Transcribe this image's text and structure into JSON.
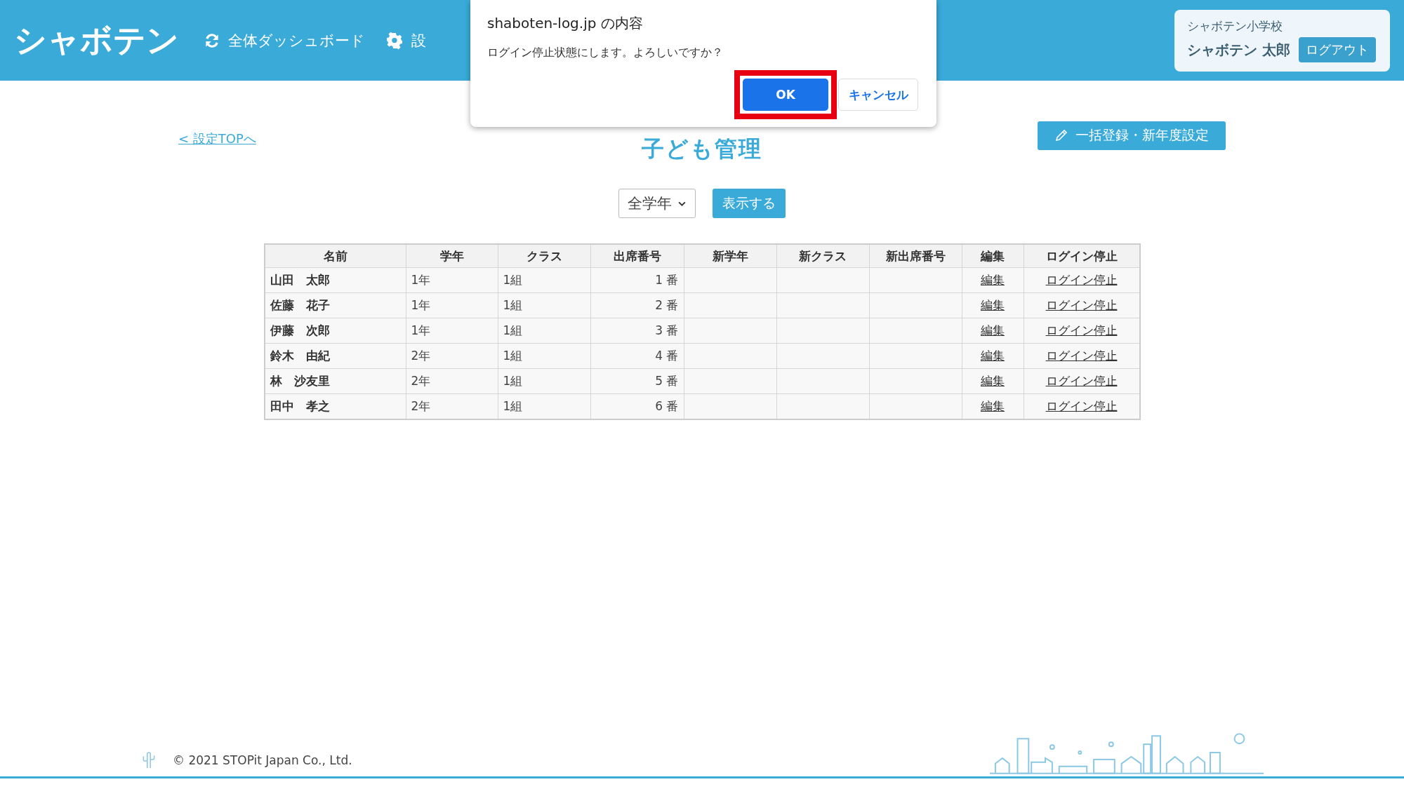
{
  "header": {
    "logo": "シャボテン",
    "nav": [
      {
        "kind": "dashboard",
        "label": "全体ダッシュボード"
      },
      {
        "kind": "settings",
        "label": "設"
      }
    ],
    "user": {
      "school": "シャボテン小学校",
      "name": "シャボテン 太郎",
      "logout": "ログアウト"
    }
  },
  "dialog": {
    "title": "shaboten-log.jp の内容",
    "message": "ログイン停止状態にします。よろしいですか？",
    "buttons": [
      {
        "label": "OK",
        "kind": "primary",
        "highlighted": true
      },
      {
        "label": "キャンセル",
        "kind": "secondary",
        "highlighted": false
      }
    ]
  },
  "page": {
    "back_link": "< 設定TOPへ",
    "title": "子ども管理",
    "bulk_button": "一括登録・新年度設定",
    "filter": {
      "value": "全学年"
    },
    "show_button": "表示する"
  },
  "table": {
    "columns": [
      "名前",
      "学年",
      "クラス",
      "出席番号",
      "新学年",
      "新クラス",
      "新出席番号",
      "編集",
      "ログイン停止"
    ],
    "rows": [
      {
        "cells": [
          "山田　太郎",
          "1年",
          "1組",
          "1 番"
        ],
        "links": [
          "編集",
          "ログイン停止"
        ]
      },
      {
        "cells": [
          "佐藤　花子",
          "1年",
          "1組",
          "2 番"
        ],
        "links": [
          "編集",
          "ログイン停止"
        ]
      },
      {
        "cells": [
          "伊藤　次郎",
          "1年",
          "1組",
          "3 番"
        ],
        "links": [
          "編集",
          "ログイン停止"
        ]
      },
      {
        "cells": [
          "鈴木　由紀",
          "2年",
          "1組",
          "4 番"
        ],
        "links": [
          "編集",
          "ログイン停止"
        ]
      },
      {
        "cells": [
          "林　沙友里",
          "2年",
          "1組",
          "5 番"
        ],
        "links": [
          "編集",
          "ログイン停止"
        ]
      },
      {
        "cells": [
          "田中　孝之",
          "2年",
          "1組",
          "6 番"
        ],
        "links": [
          "編集",
          "ログイン停止"
        ]
      }
    ]
  },
  "footer": {
    "copyright": "© 2021 STOPit Japan Co., Ltd."
  }
}
